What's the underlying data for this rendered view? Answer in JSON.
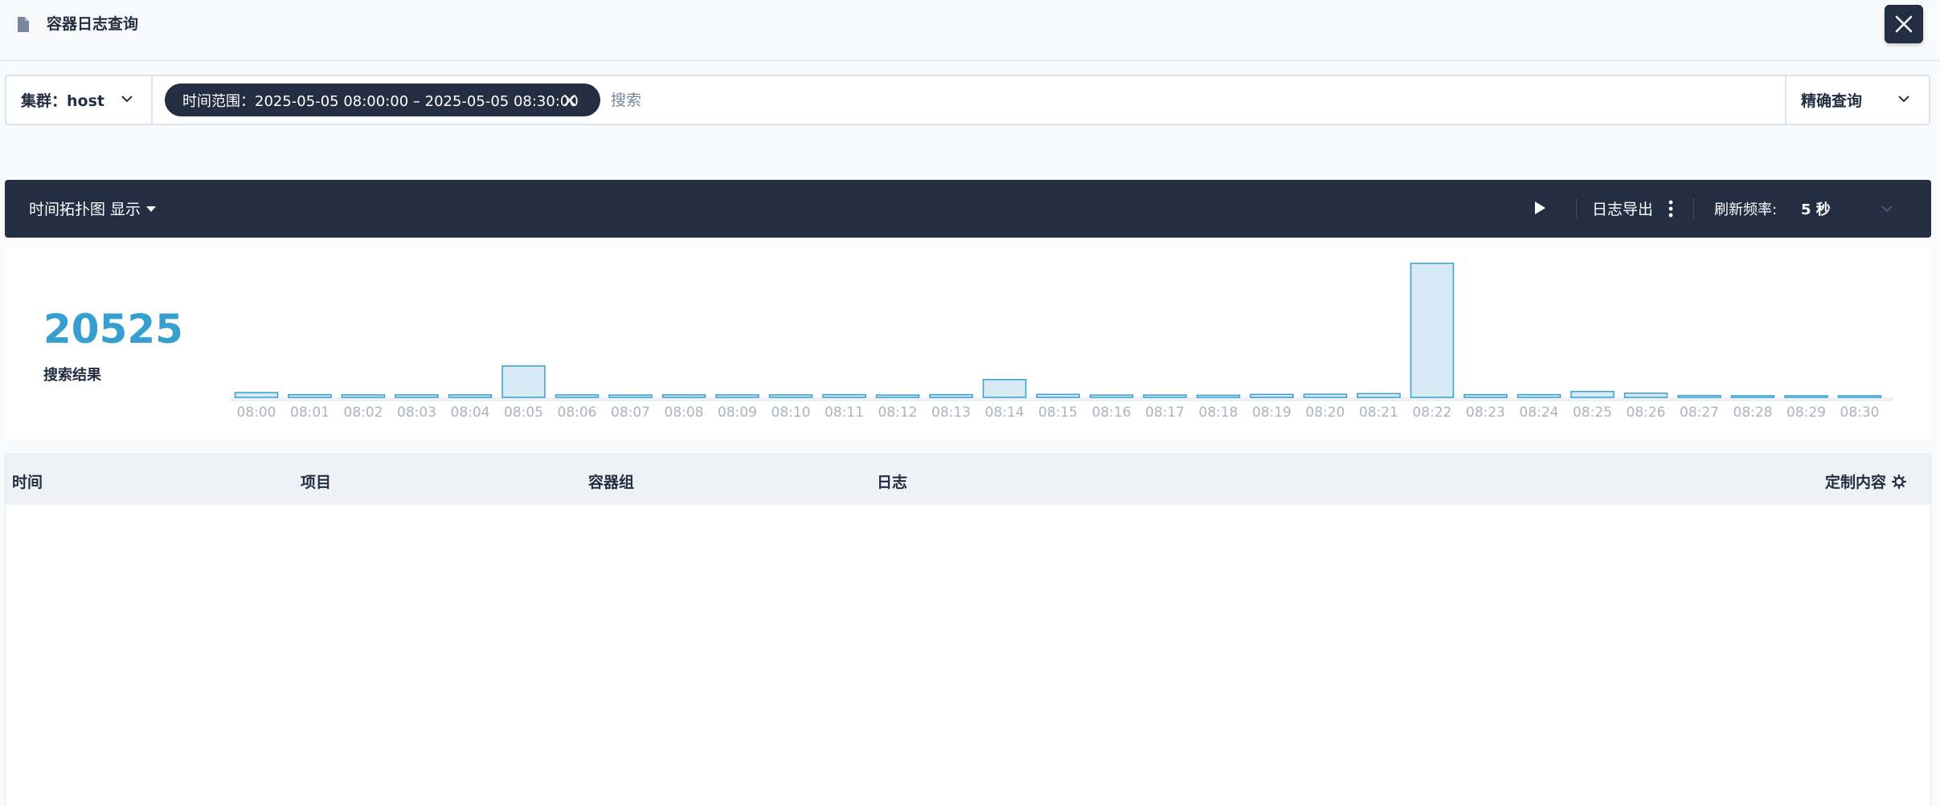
{
  "header": {
    "title": "容器日志查询",
    "icon": "document-icon",
    "close_icon": "close-icon"
  },
  "search": {
    "cluster_label": "集群：host",
    "time_range_tag": "时间范围：2025-05-05 08:00:00 – 2025-05-05 08:30:00",
    "placeholder": "搜索",
    "mode": "精确查询"
  },
  "toolbar": {
    "topology_toggle": "时间拓扑图 显示",
    "export": "日志导出",
    "refresh_label": "刷新频率:",
    "refresh_value": "5 秒"
  },
  "summary": {
    "count": "20525",
    "count_label": "搜索结果"
  },
  "chart_data": {
    "type": "bar",
    "categories": [
      "08:00",
      "08:01",
      "08:02",
      "08:03",
      "08:04",
      "08:05",
      "08:06",
      "08:07",
      "08:08",
      "08:09",
      "08:10",
      "08:11",
      "08:12",
      "08:13",
      "08:14",
      "08:15",
      "08:16",
      "08:17",
      "08:18",
      "08:19",
      "08:20",
      "08:21",
      "08:22",
      "08:23",
      "08:24",
      "08:25",
      "08:26",
      "08:27",
      "08:28",
      "08:29",
      "08:30"
    ],
    "values": [
      230,
      130,
      120,
      120,
      120,
      1500,
      120,
      110,
      120,
      120,
      120,
      130,
      110,
      130,
      850,
      140,
      110,
      110,
      100,
      140,
      150,
      180,
      6400,
      130,
      130,
      280,
      200,
      90,
      30,
      30,
      10
    ],
    "bar_fill": "#d6e9f4",
    "bar_stroke": "#369fcf"
  },
  "table": {
    "columns": [
      "时间",
      "项目",
      "容器组",
      "日志"
    ],
    "custom": "定制内容"
  },
  "colors": {
    "dark": "#242e42",
    "accent": "#369fcf"
  }
}
